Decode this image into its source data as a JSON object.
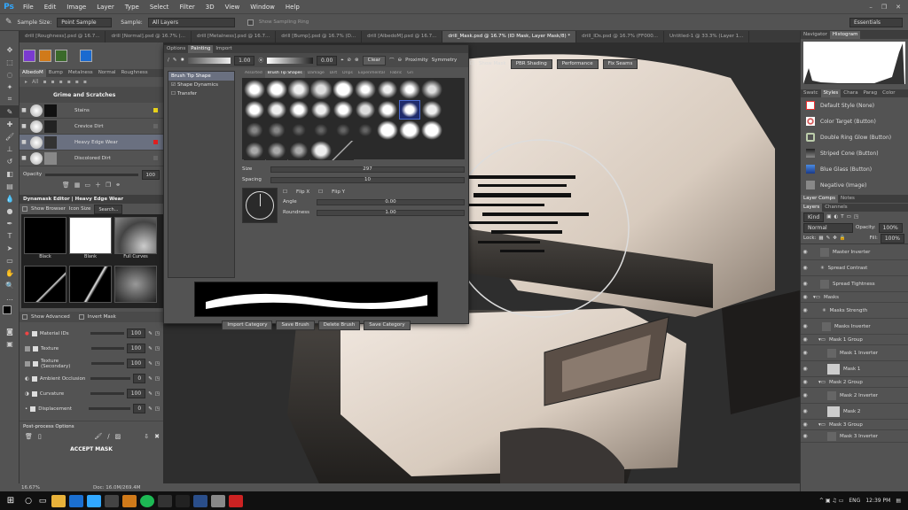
{
  "app": {
    "logo": "Ps"
  },
  "menu": [
    "File",
    "Edit",
    "Image",
    "Layer",
    "Type",
    "Select",
    "Filter",
    "3D",
    "View",
    "Window",
    "Help"
  ],
  "options": {
    "sample_size_label": "Sample Size:",
    "sample_size_value": "Point Sample",
    "sample_label": "Sample:",
    "sample_value": "All Layers",
    "show_ring": "Show Sampling Ring",
    "workspace": "Essentials"
  },
  "doc_tabs": [
    "drill [Roughness].psd @ 16.7...",
    "drill [Normal].psd @ 16.7% (...",
    "drill [Metalness].psd @ 16.7...",
    "drill [Bump].psd @ 16.7% (D...",
    "drill [AlbedoM].psd @ 16.7...",
    "drill_Mask.psd @ 16.7% (ID Mask, Layer Mask/8) *",
    "drill_IDs.psd @ 16.7% (FF000...",
    "Untitled-1 @ 33.3% (Layer 1..."
  ],
  "left": {
    "channel_tabs": [
      "AlbedoM",
      "Bump",
      "Metalness",
      "Normal",
      "Roughness"
    ],
    "all_label": "All",
    "group_name": "Grime and Scratches",
    "masks": [
      "Stains",
      "Crevice Dirt",
      "Heavy Edge Wear",
      "Discolored Dirt"
    ],
    "opacity_label": "Opacity",
    "opacity_value": "100",
    "editor_title": "Dynamask Editor | Heavy Edge Wear",
    "show_browser": "Show Browser",
    "icon_size": "Icon Size",
    "search": "Search...",
    "thumbs": [
      "Black",
      "Blank",
      "Full Curves"
    ],
    "show_advanced": "Show Advanced",
    "invert_mask": "Invert Mask",
    "sources": [
      {
        "name": "Material IDs",
        "value": "100"
      },
      {
        "name": "Texture",
        "value": "100"
      },
      {
        "name": "Texture (Secondary)",
        "value": "100"
      },
      {
        "name": "Ambient Occlusion",
        "value": "0"
      },
      {
        "name": "Curvature",
        "value": "100"
      },
      {
        "name": "Displacement",
        "value": "0"
      }
    ],
    "post_process": "Post-process Options",
    "accept": "ACCEPT MASK"
  },
  "painting": {
    "tabs": [
      "Options",
      "Painting",
      "Import"
    ],
    "size_box": "1.00",
    "flow_box": "0.00",
    "clear": "Clear",
    "proximity": "Proximity",
    "symmetry": "Symmetry",
    "show_mask": "Show Mask",
    "pbr": "PBR Shading",
    "performance": "Performance",
    "fix_seams": "Fix Seams",
    "side": [
      "Brush Tip Shape",
      "Shape Dynamics",
      "Transfer"
    ],
    "brush_tabs": [
      "Assorted",
      "Brush Tip Shapes",
      "Damage",
      "Dirt",
      "Drips",
      "Experimental",
      "Fabric",
      "Gri"
    ],
    "size_label": "Size",
    "size_value": "297",
    "spacing_label": "Spacing",
    "spacing_value": "10",
    "flip_x": "Flip X",
    "flip_y": "Flip Y",
    "angle_label": "Angle",
    "angle_value": "0.00",
    "round_label": "Roundness",
    "round_value": "1.00",
    "buttons": [
      "Import Category",
      "Save Brush",
      "Delete Brush",
      "Save Category"
    ]
  },
  "right": {
    "nav_tabs": [
      "Navigator",
      "Histogram"
    ],
    "style_tabs": [
      "Swatc",
      "Styles",
      "Chara",
      "Parag",
      "Color"
    ],
    "styles": [
      "Default Style (None)",
      "Color Target (Button)",
      "Double Ring Glow (Button)",
      "Striped Cone (Button)",
      "Blue Glass (Button)",
      "Negative (Image)"
    ],
    "comp_tabs": [
      "Layer Comps",
      "Notes"
    ],
    "layer_tabs": [
      "Layers",
      "Channels"
    ],
    "kind": "Kind",
    "blend": "Normal",
    "opacity_label": "Opacity:",
    "opacity_value": "100%",
    "lock_label": "Lock:",
    "fill_label": "Fill:",
    "fill_value": "100%",
    "layers": [
      "Master Inverter",
      "Spread Contrast",
      "Spread Tightness",
      "Masks",
      "Masks Strength",
      "Masks Inverter",
      "Mask 1 Group",
      "Mask 1 Inverter",
      "Mask 1",
      "Mask 2 Group",
      "Mask 2 Inverter",
      "Mask 2",
      "Mask 3 Group",
      "Mask 3 Inverter"
    ]
  },
  "status": {
    "zoom": "16.67%",
    "doc": "Doc: 16.0M/269.4M"
  },
  "taskbar": {
    "time": "12:39 PM",
    "lang": "ENG"
  }
}
